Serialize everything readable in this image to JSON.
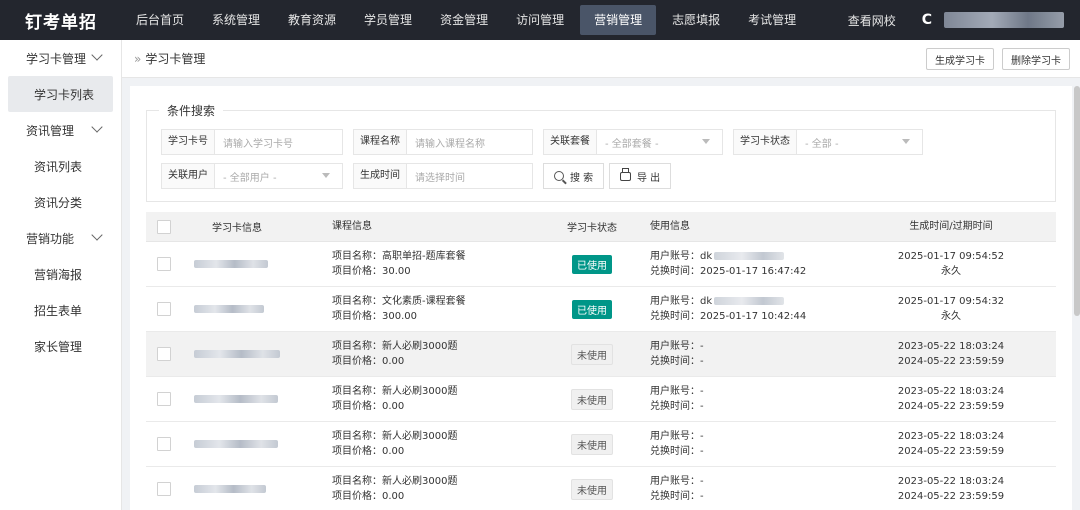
{
  "app": {
    "logo": "钉考单招"
  },
  "topnav": {
    "items": [
      "后台首页",
      "系统管理",
      "教育资源",
      "学员管理",
      "资金管理",
      "访问管理",
      "营销管理",
      "志愿填报",
      "考试管理"
    ],
    "active_index": 6,
    "view_school": "查看网校",
    "refresh_icon": "C"
  },
  "sidebar": {
    "groups": [
      {
        "label": "学习卡管理",
        "items": [
          "学习卡列表"
        ]
      },
      {
        "label": "资讯管理",
        "items": [
          "资讯列表",
          "资讯分类"
        ]
      },
      {
        "label": "营销功能",
        "items": [
          "营销海报",
          "招生表单",
          "家长管理"
        ]
      }
    ]
  },
  "breadcrumb": {
    "sep": "»",
    "text": "学习卡管理"
  },
  "actions": {
    "generate": "生成学习卡",
    "delete": "删除学习卡"
  },
  "search": {
    "legend": "条件搜索",
    "card_no": {
      "label": "学习卡号",
      "placeholder": "请输入学习卡号"
    },
    "course": {
      "label": "课程名称",
      "placeholder": "请输入课程名称"
    },
    "package": {
      "label": "关联套餐",
      "value": "- 全部套餐 -"
    },
    "status": {
      "label": "学习卡状态",
      "value": "- 全部 -"
    },
    "user": {
      "label": "关联用户",
      "value": "- 全部用户 -"
    },
    "time": {
      "label": "生成时间",
      "placeholder": "请选择时间"
    },
    "search_btn": "搜 索",
    "export_btn": "导 出"
  },
  "table": {
    "headers": {
      "card": "学习卡信息",
      "course": "课程信息",
      "status": "学习卡状态",
      "use": "使用信息",
      "time": "生成时间/过期时间"
    },
    "rows": [
      {
        "course_name": "项目名称：高职单招-题库套餐",
        "price": "项目价格：30.00",
        "status": "已使用",
        "used": true,
        "account": "用户账号：dk",
        "redeem": "兑换时间：2025-01-17 16:47:42",
        "gen": "2025-01-17 09:54:52",
        "exp": "永久"
      },
      {
        "course_name": "项目名称：文化素质-课程套餐",
        "price": "项目价格：300.00",
        "status": "已使用",
        "used": true,
        "account": "用户账号：dk",
        "redeem": "兑换时间：2025-01-17 10:42:44",
        "gen": "2025-01-17 09:54:32",
        "exp": "永久"
      },
      {
        "course_name": "项目名称：新人必刷3000题",
        "price": "项目价格：0.00",
        "status": "未使用",
        "used": false,
        "account": "用户账号：-",
        "redeem": "兑换时间：-",
        "gen": "2023-05-22 18:03:24",
        "exp": "2024-05-22 23:59:59"
      },
      {
        "course_name": "项目名称：新人必刷3000题",
        "price": "项目价格：0.00",
        "status": "未使用",
        "used": false,
        "account": "用户账号：-",
        "redeem": "兑换时间：-",
        "gen": "2023-05-22 18:03:24",
        "exp": "2024-05-22 23:59:59"
      },
      {
        "course_name": "项目名称：新人必刷3000题",
        "price": "项目价格：0.00",
        "status": "未使用",
        "used": false,
        "account": "用户账号：-",
        "redeem": "兑换时间：-",
        "gen": "2023-05-22 18:03:24",
        "exp": "2024-05-22 23:59:59"
      },
      {
        "course_name": "项目名称：新人必刷3000题",
        "price": "项目价格：0.00",
        "status": "未使用",
        "used": false,
        "account": "用户账号：-",
        "redeem": "兑换时间：-",
        "gen": "2023-05-22 18:03:24",
        "exp": "2024-05-22 23:59:59"
      }
    ]
  }
}
